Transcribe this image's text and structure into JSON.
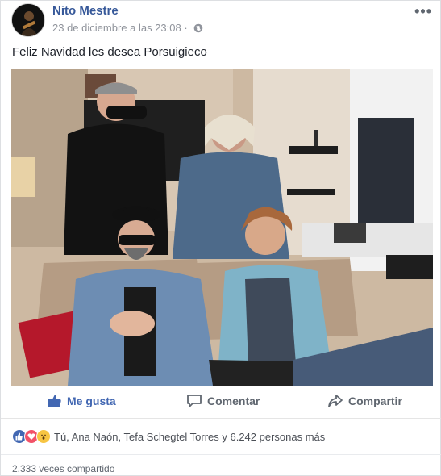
{
  "post": {
    "author": "Nito Mestre",
    "timestamp": "23 de diciembre a las 23:08",
    "privacy_icon": "globe-icon",
    "more_icon": "ellipsis-icon",
    "status_text": "Feliz Navidad les desea Porsuigieco"
  },
  "actions": {
    "like_label": "Me gusta",
    "comment_label": "Comentar",
    "share_label": "Compartir"
  },
  "reactions": {
    "icons": [
      "like-reaction-icon",
      "love-reaction-icon",
      "wow-reaction-icon"
    ],
    "summary": "Tú, Ana Naón, Tefa Schegtel Torres y 6.242 personas más"
  },
  "shares": {
    "text": "2.333 veces compartido"
  },
  "colors": {
    "link": "#365899",
    "like_blue": "#4267b2",
    "muted": "#90949c"
  }
}
